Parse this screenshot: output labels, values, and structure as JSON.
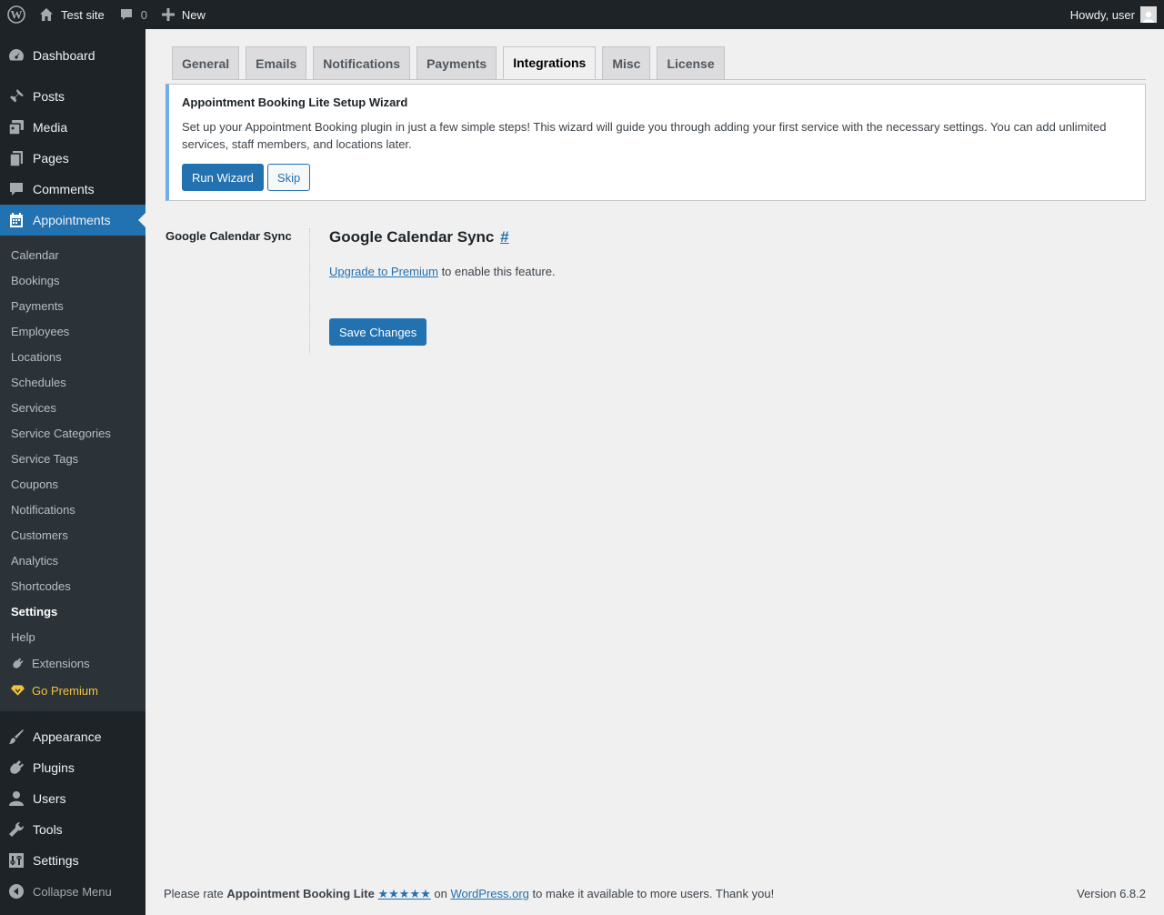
{
  "adminbar": {
    "site_name": "Test site",
    "comments_count": "0",
    "new_label": "New",
    "greeting": "Howdy, user"
  },
  "sidebar": {
    "top_items": [
      {
        "label": "Dashboard",
        "icon": "dashboard-icon"
      },
      {
        "label": "Posts",
        "icon": "pushpin-icon"
      },
      {
        "label": "Media",
        "icon": "media-icon"
      },
      {
        "label": "Pages",
        "icon": "pages-icon"
      },
      {
        "label": "Comments",
        "icon": "comment-bubble-icon"
      },
      {
        "label": "Appointments",
        "icon": "calendar-icon"
      }
    ],
    "submenu": [
      "Calendar",
      "Bookings",
      "Payments",
      "Employees",
      "Locations",
      "Schedules",
      "Services",
      "Service Categories",
      "Service Tags",
      "Coupons",
      "Notifications",
      "Customers",
      "Analytics",
      "Shortcodes",
      "Settings",
      "Help"
    ],
    "extensions_label": "Extensions",
    "premium_label": "Go Premium",
    "bottom_items": [
      {
        "label": "Appearance",
        "icon": "paintbrush-icon"
      },
      {
        "label": "Plugins",
        "icon": "plugin-icon"
      },
      {
        "label": "Users",
        "icon": "users-icon"
      },
      {
        "label": "Tools",
        "icon": "wrench-icon"
      },
      {
        "label": "Settings",
        "icon": "settings-sliders-icon"
      }
    ],
    "collapse_label": "Collapse Menu"
  },
  "tabs": [
    "General",
    "Emails",
    "Notifications",
    "Payments",
    "Integrations",
    "Misc",
    "License"
  ],
  "active_tab": "Integrations",
  "notice": {
    "title": "Appointment Booking Lite Setup Wizard",
    "text": "Set up your Appointment Booking plugin in just a few simple steps! This wizard will guide you through adding your first service with the necessary settings. You can add unlimited services, staff members, and locations later.",
    "run_label": "Run Wizard",
    "skip_label": "Skip"
  },
  "section": {
    "label": "Google Calendar Sync",
    "heading": "Google Calendar Sync",
    "anchor": "#",
    "upgrade_link": "Upgrade to Premium",
    "upgrade_rest": " to enable this feature.",
    "save_label": "Save Changes"
  },
  "footer": {
    "pre": "Please rate ",
    "plugin_name": "Appointment Booking Lite",
    "stars": "★★★★★",
    "on": " on ",
    "wporg": "WordPress.org",
    "post": " to make it available to more users. Thank you!",
    "version": "Version 6.8.2"
  },
  "colors": {
    "accent": "#2271b1",
    "adminbar_bg": "#1d2327",
    "submenu_bg": "#2c3338",
    "premium": "#f0c33c",
    "notice_border": "#72aee6"
  }
}
